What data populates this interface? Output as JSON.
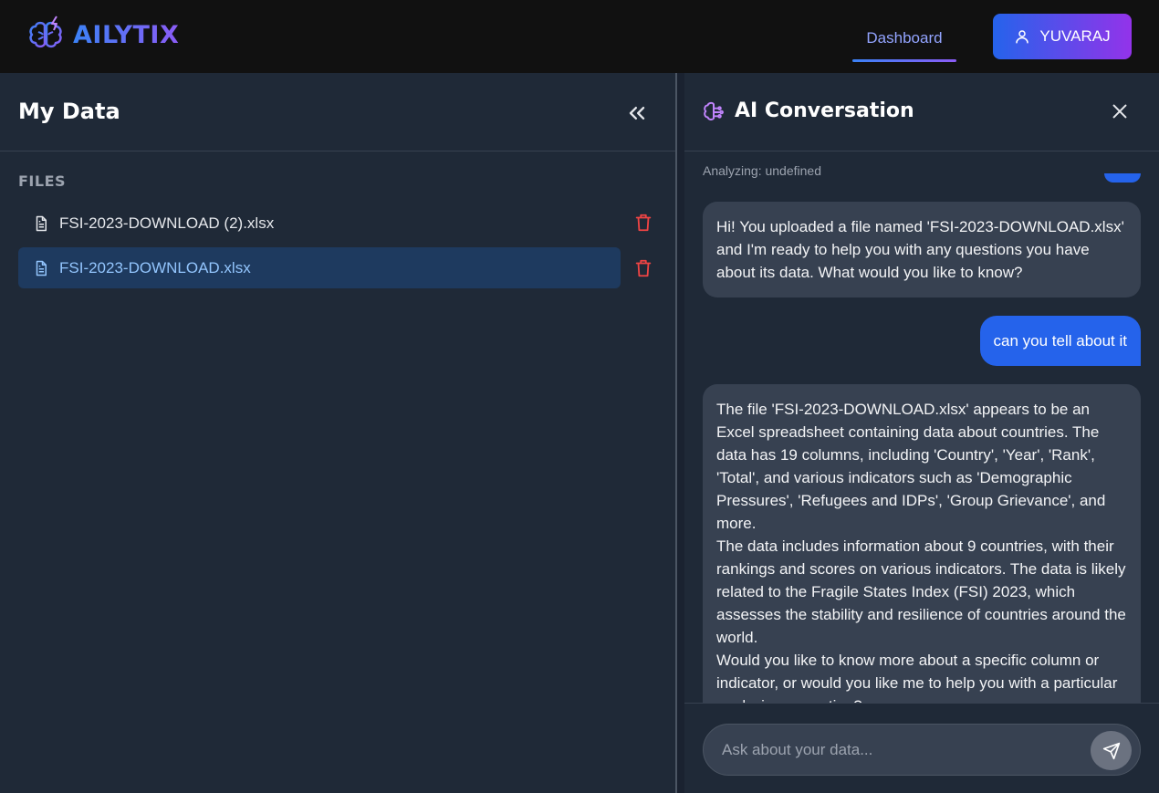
{
  "header": {
    "brand": "AILYTIX",
    "nav_tab": "Dashboard",
    "user_name": "YUVARAJ"
  },
  "sidebar": {
    "title": "My Data",
    "files_label": "FILES",
    "files": [
      {
        "name": "FSI-2023-DOWNLOAD (2).xlsx",
        "active": false
      },
      {
        "name": "FSI-2023-DOWNLOAD.xlsx",
        "active": true
      }
    ]
  },
  "chat": {
    "title": "AI Conversation",
    "analyzing": "Analyzing: undefined",
    "messages": [
      {
        "role": "assistant",
        "text": "Hi! You uploaded a file named 'FSI-2023-DOWNLOAD.xlsx' and I'm ready to help you with any questions you have about its data. What would you like to know?"
      },
      {
        "role": "user",
        "text": "can you tell about it"
      },
      {
        "role": "assistant",
        "paragraphs": [
          "The file 'FSI-2023-DOWNLOAD.xlsx' appears to be an Excel spreadsheet containing data about countries. The data has 19 columns, including 'Country', 'Year', 'Rank', 'Total', and various indicators such as 'Demographic Pressures', 'Refugees and IDPs', 'Group Grievance', and more.",
          "The data includes information about 9 countries, with their rankings and scores on various indicators. The data is likely related to the Fragile States Index (FSI) 2023, which assesses the stability and resilience of countries around the world.",
          "Would you like to know more about a specific column or indicator, or would you like me to help you with a particular analysis or question?"
        ]
      }
    ],
    "input_placeholder": "Ask about your data..."
  },
  "colors": {
    "accent_blue": "#2563eb",
    "accent_purple": "#9333ea",
    "danger": "#ef4444",
    "panel_bg": "#1f2937",
    "bubble_ai": "#374151"
  },
  "icons": [
    "brain-icon",
    "user-icon",
    "double-chevron-left-icon",
    "file-icon",
    "trash-icon",
    "brain-chat-icon",
    "close-icon",
    "send-icon"
  ]
}
